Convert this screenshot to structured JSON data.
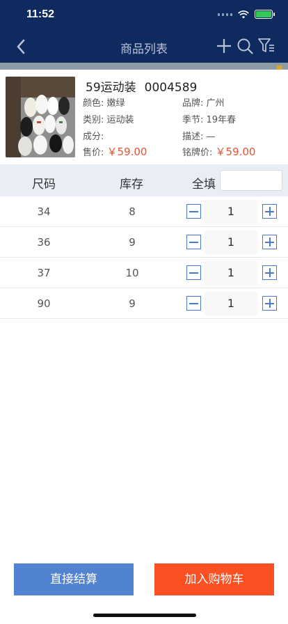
{
  "status": {
    "time": "11:52"
  },
  "nav": {
    "title": "商品列表",
    "icons": [
      "back-chevron-icon",
      "plus-icon",
      "search-icon",
      "filter-icon"
    ]
  },
  "product": {
    "name": "59运动装",
    "code": "0004589",
    "color_label": "颜色:",
    "color_value": "嫩绿",
    "brand_label": "品牌:",
    "brand_value": "广州",
    "category_label": "类别:",
    "category_value": "运动装",
    "season_label": "季节:",
    "season_value": "19年春",
    "material_label": "成分:",
    "material_value": "",
    "desc_label": "描述:",
    "desc_value": "—",
    "price_label": "售价:",
    "price_value": "￥59.00",
    "tag_price_label": "铭牌价:",
    "tag_price_value": "￥59.00"
  },
  "table": {
    "col_size": "尺码",
    "col_stock": "库存",
    "col_fill_all": "全填",
    "fill_all_placeholder": "",
    "rows": [
      {
        "size": "34",
        "stock": "8",
        "qty": "1"
      },
      {
        "size": "36",
        "stock": "9",
        "qty": "1"
      },
      {
        "size": "37",
        "stock": "10",
        "qty": "1"
      },
      {
        "size": "90",
        "stock": "9",
        "qty": "1"
      }
    ]
  },
  "actions": {
    "checkout": "直接结算",
    "add_cart": "加入购物车"
  },
  "colors": {
    "nav_bg": "#0e2a5e",
    "price": "#e8542f",
    "checkout_bg": "#5283d0",
    "cart_bg": "#fc4f22",
    "stepper": "#4a7bd0"
  }
}
